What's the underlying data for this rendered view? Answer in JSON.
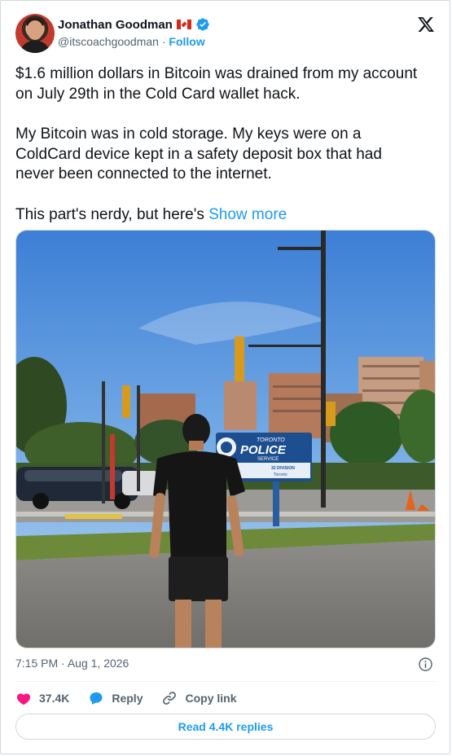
{
  "author": {
    "name": "Jonathan Goodman",
    "handle": "@itscoachgoodman",
    "separator": "·",
    "follow_label": "Follow",
    "flag_icon": "canada-flag-icon",
    "verified_icon": "verified-badge-icon",
    "verified_color": "#1d9bf0"
  },
  "brand_icon": "x-logo-icon",
  "post": {
    "paragraph_1": "$1.6 million dollars in Bitcoin was drained from my account on July 29th in the Cold Card wallet hack.",
    "paragraph_2": "My Bitcoin was in cold storage. My keys were on a ColdCard device kept in a safety deposit box that had never been connected to the internet.",
    "paragraph_3": "This part's nerdy, but here's ",
    "show_more": "Show more"
  },
  "media": {
    "sign_city": "TORONTO",
    "sign_title": "POLICE",
    "sign_sub": "SERVICE",
    "sign_division": "32 DIVISION",
    "sign_brand": "Toronto"
  },
  "meta": {
    "time": "7:15 PM",
    "separator": "·",
    "date": "Aug 1, 2026",
    "info_icon": "info-icon"
  },
  "actions": {
    "likes": "37.4K",
    "reply_label": "Reply",
    "copy_label": "Copy link",
    "heart_color": "#f91880",
    "reply_color": "#1d9bf0"
  },
  "read_replies": "Read 4.4K replies"
}
